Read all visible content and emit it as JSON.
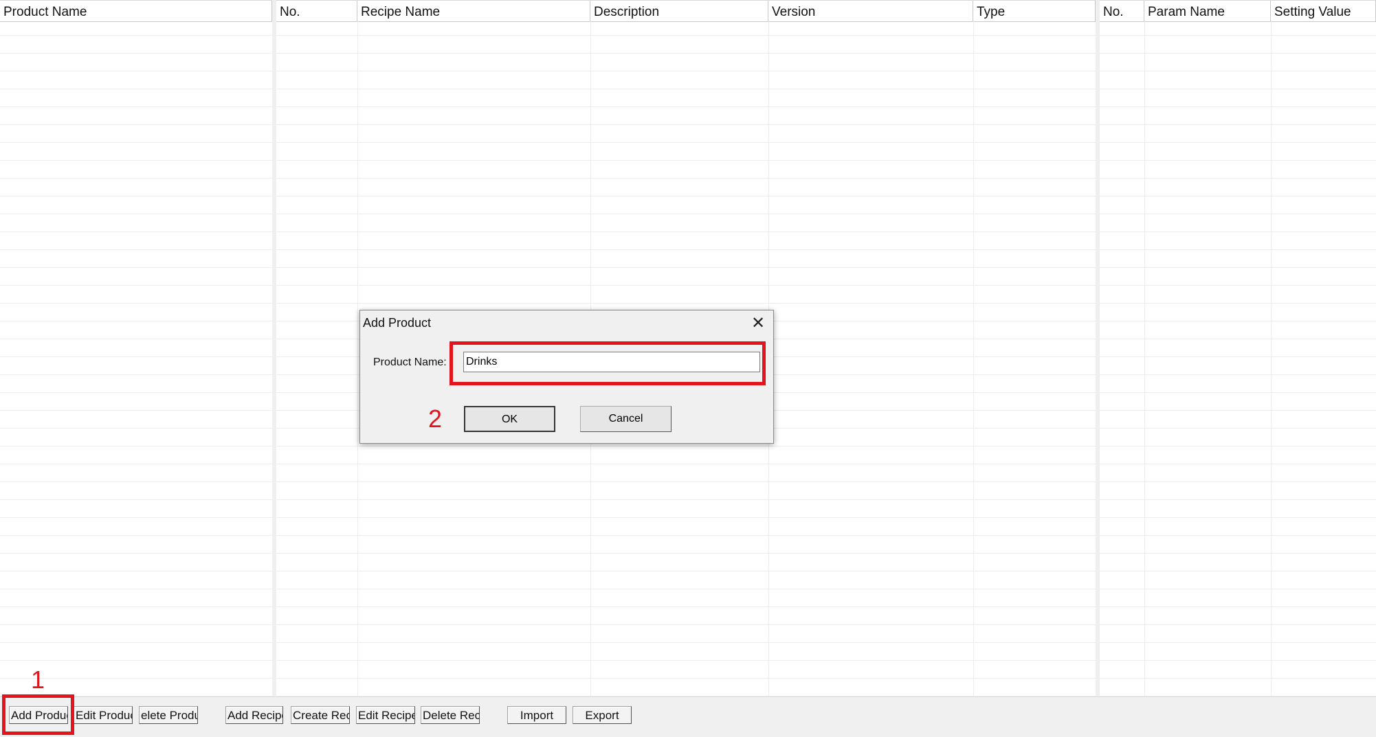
{
  "products_table": {
    "columns": [
      "Product Name"
    ]
  },
  "recipes_table": {
    "columns": [
      "No.",
      "Recipe Name",
      "Description",
      "Version",
      "Type"
    ]
  },
  "params_table": {
    "columns": [
      "No.",
      "Param Name",
      "Setting Value"
    ]
  },
  "toolbar": {
    "buttons": [
      "Add Produc",
      "Edit Product",
      "elete Produ",
      "Add Recipe",
      "Create Recip",
      "Edit Recipe",
      "Delete Recip",
      "Import",
      "Export"
    ]
  },
  "dialog": {
    "title": "Add Product",
    "close_glyph": "✕",
    "label": "Product Name:",
    "input_value": "Drinks",
    "ok_label": "OK",
    "cancel_label": "Cancel"
  },
  "annotations": {
    "step1": "1",
    "step2": "2",
    "color": "#e3141c"
  }
}
